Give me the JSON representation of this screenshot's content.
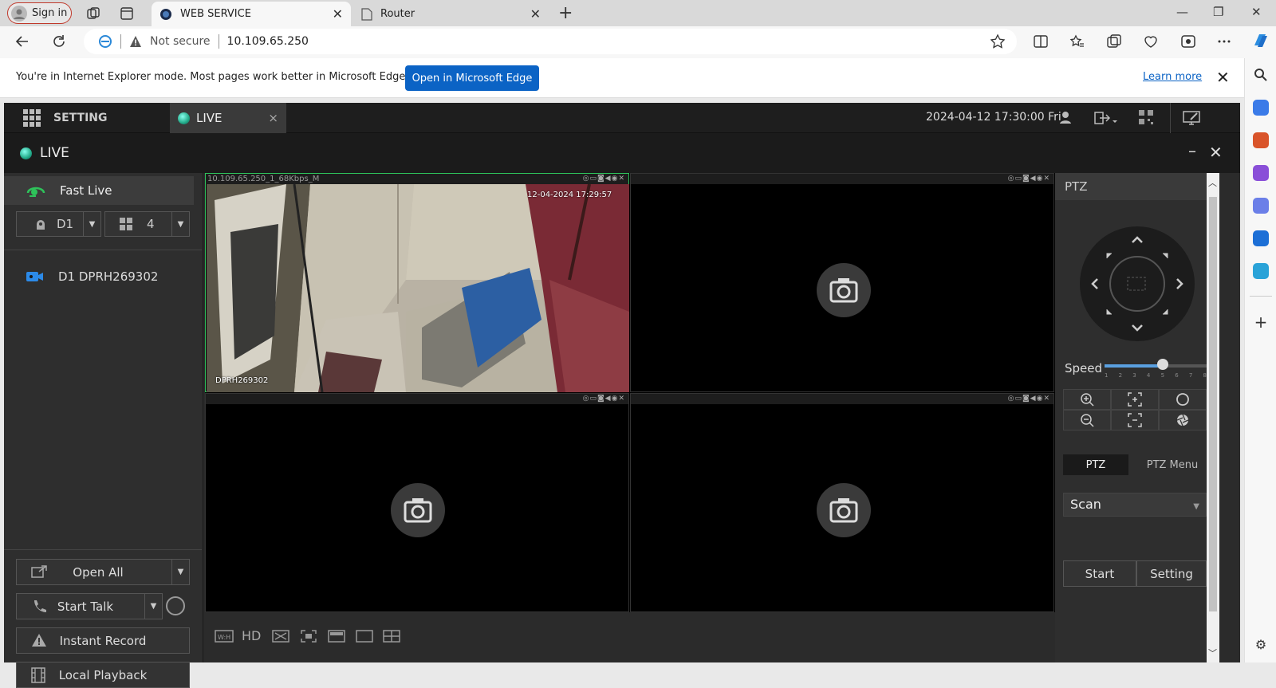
{
  "browser": {
    "profile_label": "Sign in",
    "tabs": [
      {
        "title": "WEB SERVICE",
        "close": "✕"
      },
      {
        "title": "Router",
        "close": "✕"
      }
    ],
    "new_tab": "+",
    "window": {
      "minimize": "—",
      "restore": "❐",
      "close": "✕"
    },
    "security_label": "Not secure",
    "url": "10.109.65.250",
    "ie_message": "You're in Internet Explorer mode. Most pages work better in Microsoft Edge.",
    "open_edge_label": "Open in Microsoft Edge",
    "learn_more_label": "Learn more",
    "accent": "#0b63c5"
  },
  "app": {
    "setting_label": "SETTING",
    "live_tab_label": "LIVE",
    "live_tab_close": "×",
    "datetime": "2024-04-12 17:30:00 Fri",
    "live_title": "LIVE",
    "live_min": "–",
    "live_close": "✕",
    "left": {
      "fast_live": "Fast Live",
      "device_select": "D1",
      "layout_select": "4",
      "device_name": "D1 DPRH269302",
      "buttons": {
        "open_all": "Open All",
        "start_talk": "Start Talk",
        "instant_record": "Instant Record",
        "local_playback": "Local Playback"
      }
    },
    "video": {
      "cell1_info": "10.109.65.250_1_68Kbps_M",
      "cell1_time": "12-04-2024 17:29:57",
      "cell1_label": "DPRH269302",
      "cell_icons": "◎▭◙◀◉✕",
      "bottom_hd": "HD"
    },
    "ptz": {
      "title": "PTZ",
      "speed_label": "Speed",
      "speed_level": 5,
      "speed_ticks": [
        "1",
        "2",
        "3",
        "4",
        "5",
        "6",
        "7",
        "8"
      ],
      "tab_ptz": "PTZ",
      "tab_menu": "PTZ Menu",
      "scan_value": "Scan",
      "start": "Start",
      "setting": "Setting"
    }
  }
}
